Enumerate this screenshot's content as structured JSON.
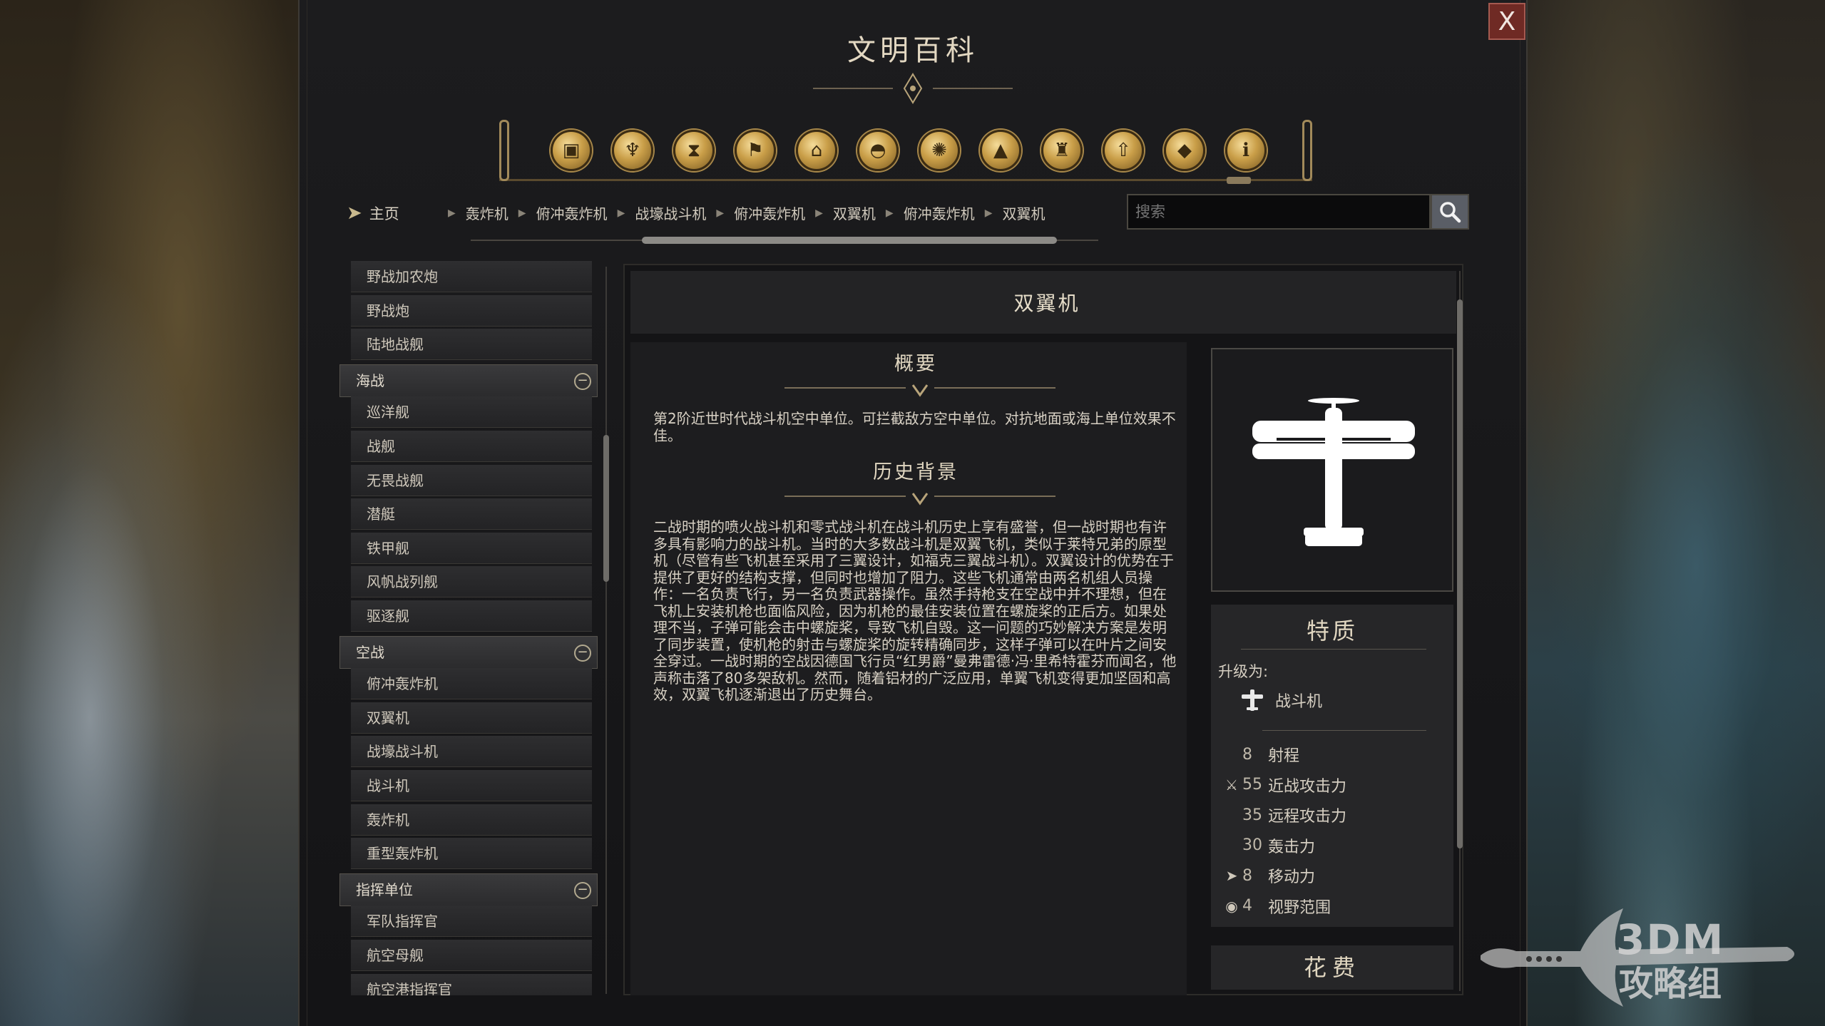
{
  "window": {
    "title": "文明百科",
    "close_label": "X"
  },
  "category_icons": [
    "crate-icon",
    "chalice-icon",
    "hourglass-icon",
    "flag-icon",
    "museum-icon",
    "dome-icon",
    "atom-icon",
    "mountain-icon",
    "tower-icon",
    "up-arrow-icon",
    "book-icon",
    "info-icon"
  ],
  "nav": {
    "home_label": "主页",
    "breadcrumbs": [
      "轰炸机",
      "俯冲轰炸机",
      "战壕战斗机",
      "俯冲轰炸机",
      "双翼机",
      "俯冲轰炸机",
      "双翼机"
    ]
  },
  "search": {
    "placeholder": "搜索"
  },
  "list": {
    "items": [
      {
        "label": "野战加农炮",
        "group": false
      },
      {
        "label": "野战炮",
        "group": false
      },
      {
        "label": "陆地战舰",
        "group": false
      },
      {
        "label": "海战",
        "group": true,
        "toggle": "−"
      },
      {
        "label": "巡洋舰",
        "group": false
      },
      {
        "label": "战舰",
        "group": false
      },
      {
        "label": "无畏战舰",
        "group": false
      },
      {
        "label": "潜艇",
        "group": false
      },
      {
        "label": "铁甲舰",
        "group": false
      },
      {
        "label": "风帆战列舰",
        "group": false
      },
      {
        "label": "驱逐舰",
        "group": false
      },
      {
        "label": "空战",
        "group": true,
        "toggle": "−"
      },
      {
        "label": "俯冲轰炸机",
        "group": false
      },
      {
        "label": "双翼机",
        "group": false
      },
      {
        "label": "战壕战斗机",
        "group": false
      },
      {
        "label": "战斗机",
        "group": false
      },
      {
        "label": "轰炸机",
        "group": false
      },
      {
        "label": "重型轰炸机",
        "group": false
      },
      {
        "label": "指挥单位",
        "group": true,
        "toggle": "−"
      },
      {
        "label": "军队指挥官",
        "group": false
      },
      {
        "label": "航空母舰",
        "group": false
      },
      {
        "label": "航空港指挥官",
        "group": false
      }
    ]
  },
  "detail": {
    "title": "双翼机",
    "overview_title": "概要",
    "overview_text": "第2阶近世时代战斗机空中单位。可拦截敌方空中单位。对抗地面或海上单位效果不佳。",
    "history_title": "历史背景",
    "history_text": "二战时期的喷火战斗机和零式战斗机在战斗机历史上享有盛誉，但一战时期也有许多具有影响力的战斗机。当时的大多数战斗机是双翼飞机，类似于莱特兄弟的原型机（尽管有些飞机甚至采用了三翼设计，如福克三翼战斗机）。双翼设计的优势在于提供了更好的结构支撑，但同时也增加了阻力。这些飞机通常由两名机组人员操作：一名负责飞行，另一名负责武器操作。虽然手持枪支在空战中并不理想，但在飞机上安装机枪也面临风险，因为机枪的最佳安装位置在螺旋桨的正后方。如果处理不当，子弹可能会击中螺旋桨，导致飞机自毁。这一问题的巧妙解决方案是发明了同步装置，使机枪的射击与螺旋桨的旋转精确同步，这样子弹可以在叶片之间安全穿过。一战时期的空战因德国飞行员“红男爵”曼弗雷德·冯·里希特霍芬而闻名，他声称击落了80多架敌机。然而，随着铝材的广泛应用，单翼飞机变得更加坚固和高效，双翼飞机逐渐退出了历史舞台。",
    "traits": {
      "title": "特质",
      "upgrade_label": "升级为:",
      "upgrade_target": "战斗机",
      "stats": [
        {
          "icon": "",
          "value": "8",
          "label": "射程"
        },
        {
          "icon": "melee-icon",
          "value": "55",
          "label": "近战攻击力"
        },
        {
          "icon": "",
          "value": "35",
          "label": "远程攻击力"
        },
        {
          "icon": "",
          "value": "30",
          "label": "轰击力"
        },
        {
          "icon": "movement-icon",
          "value": "8",
          "label": "移动力"
        },
        {
          "icon": "eye-icon",
          "value": "4",
          "label": "视野范围"
        }
      ]
    },
    "cost_title": "花费"
  },
  "watermark": {
    "line1": "3DM",
    "line2": "攻略组"
  },
  "colors": {
    "gold": "#c99e48",
    "close_red": "#6f2a24",
    "panel": "#1c1c1e"
  }
}
